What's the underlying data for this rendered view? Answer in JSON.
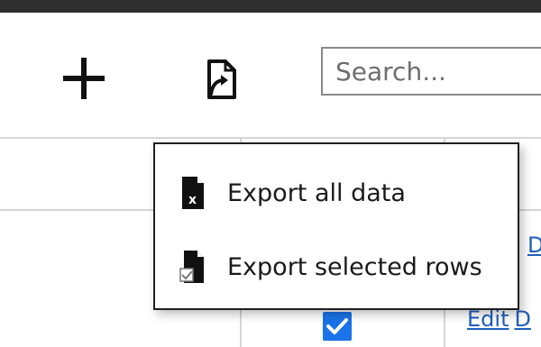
{
  "toolbar": {
    "add_icon": "plus-icon",
    "export_icon": "export-file-icon",
    "search": {
      "placeholder": "Search...",
      "value": ""
    }
  },
  "export_menu": {
    "items": [
      {
        "label": "Export all data",
        "icon": "excel-file-icon"
      },
      {
        "label": "Export selected rows",
        "icon": "file-checked-icon"
      }
    ]
  },
  "table": {
    "rows": [
      {
        "edit_label": "",
        "delete_label": "D",
        "selected": false
      },
      {
        "edit_label": "Edit",
        "delete_label": "D",
        "selected": true
      }
    ]
  },
  "colors": {
    "accent": "#1a73e8",
    "link": "#1f5fbf",
    "topbar": "#2f2f2f"
  }
}
